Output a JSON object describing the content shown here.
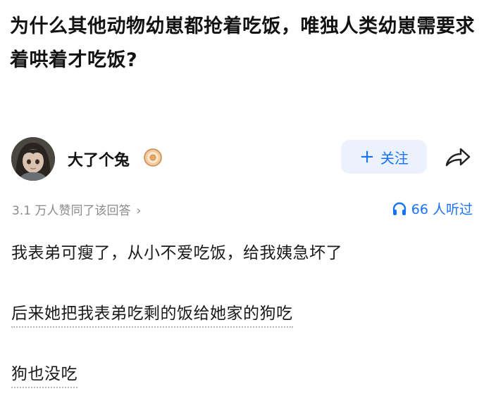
{
  "question": {
    "title": "为什么其他动物幼崽都抢着吃饭，唯独人类幼崽需要求着哄着才吃饭?"
  },
  "author": {
    "name": "大了个兔",
    "badge_icon": "donut-badge-icon",
    "follow_label": "关注",
    "follow_plus": "+",
    "share_icon": "share-arrow-icon"
  },
  "meta": {
    "upvote_text": "3.1 万人赞同了该回答",
    "upvote_chevron": "›",
    "listen_count": "66 人听过",
    "listen_icon": "headphones-icon"
  },
  "answer": {
    "lines": [
      "我表弟可瘦了，从小不爱吃饭，给我姨急坏了",
      "后来她把我表弟吃剩的饭给她家的狗吃",
      "狗也没吃"
    ]
  },
  "colors": {
    "accent": "#1772f6",
    "follow_bg": "#ebf2fd",
    "muted": "#8a8a8a"
  }
}
